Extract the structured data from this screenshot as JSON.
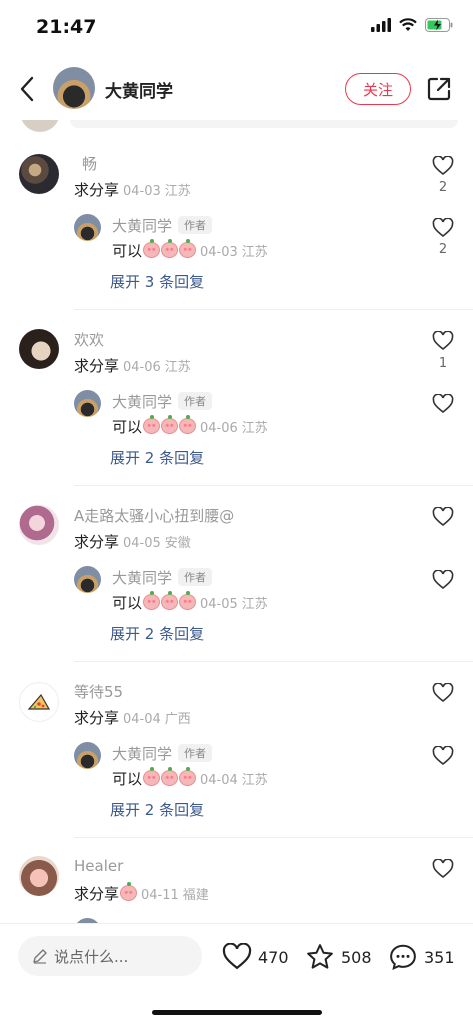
{
  "status_bar": {
    "time": "21:47"
  },
  "header": {
    "author_name": "大黄同学",
    "follow_label": "关注"
  },
  "comments": [
    {
      "user": "畅",
      "text": "求分享",
      "date": "04-03",
      "location": "江苏",
      "likes": "2",
      "reply": {
        "user": "大黄同学",
        "tag": "作者",
        "text": "可以",
        "date": "04-03",
        "location": "江苏",
        "likes": "2"
      },
      "expand": "展开 3 条回复"
    },
    {
      "user": "欢欢",
      "text": "求分享",
      "date": "04-06",
      "location": "江苏",
      "likes": "1",
      "reply": {
        "user": "大黄同学",
        "tag": "作者",
        "text": "可以",
        "date": "04-06",
        "location": "江苏",
        "likes": ""
      },
      "expand": "展开 2 条回复"
    },
    {
      "user": "A走路太骚小心扭到腰@",
      "text": "求分享",
      "date": "04-05",
      "location": "安徽",
      "likes": "",
      "reply": {
        "user": "大黄同学",
        "tag": "作者",
        "text": "可以",
        "date": "04-05",
        "location": "江苏",
        "likes": ""
      },
      "expand": "展开 2 条回复"
    },
    {
      "user": "等待55",
      "text": "求分享",
      "date": "04-04",
      "location": "广西",
      "likes": "",
      "reply": {
        "user": "大黄同学",
        "tag": "作者",
        "text": "可以",
        "date": "04-04",
        "location": "江苏",
        "likes": ""
      },
      "expand": "展开 2 条回复"
    },
    {
      "user": "Healer",
      "text": "求分享",
      "date": "04-11",
      "location": "福建",
      "likes": ""
    }
  ],
  "bottom_bar": {
    "input_placeholder": "说点什么...",
    "likes": "470",
    "favorites": "508",
    "comments": "351"
  },
  "colors": {
    "accent": "#e8384f",
    "link": "#3b5a8a"
  }
}
